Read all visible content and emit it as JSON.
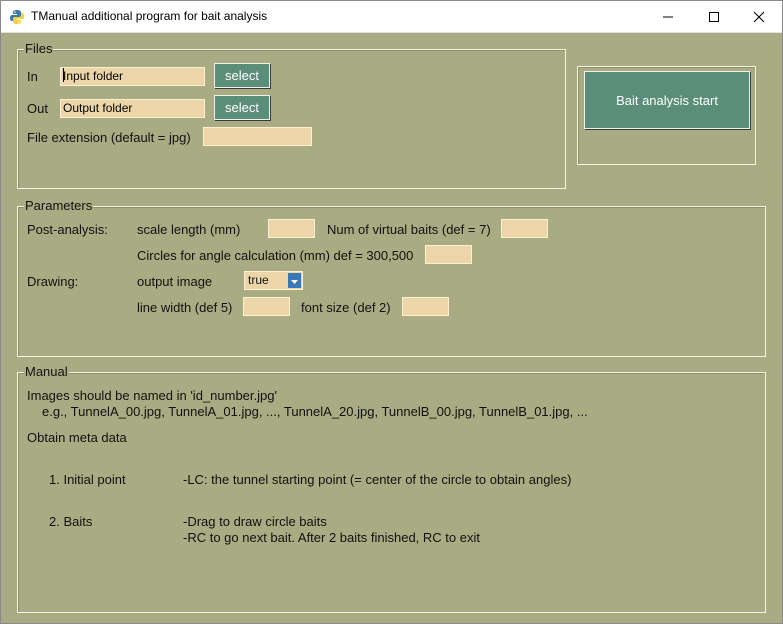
{
  "window": {
    "title": "TManual additional program for bait analysis"
  },
  "files": {
    "legend": "Files",
    "in_label": "In",
    "in_value": "Input folder",
    "out_label": "Out",
    "out_value": "Output folder",
    "select_label": "select",
    "ext_label": "File extension (default = jpg)",
    "ext_value": ""
  },
  "start_button": {
    "label": "Bait analysis start"
  },
  "params": {
    "legend": "Parameters",
    "post_label": "Post-analysis:",
    "scale_label": "scale length (mm)",
    "num_baits_label": "Num of virtual baits (def = 7)",
    "circles_label": "Circles for angle calculation (mm) def = 300,500",
    "drawing_label": "Drawing:",
    "output_image_label": "output image",
    "output_image_value": "true",
    "line_width_label": "line width (def 5)",
    "font_size_label": "font size (def 2)"
  },
  "manual": {
    "legend": "Manual",
    "line1": "Images should be named in 'id_number.jpg'",
    "line2": "e.g., TunnelA_00.jpg, TunnelA_01.jpg, ..., TunnelA_20.jpg, TunnelB_00.jpg, TunnelB_01.jpg, ...",
    "line3": "Obtain meta data",
    "step1_label": "1. Initial point",
    "step1_desc": "-LC: the tunnel starting point (= center of the circle to obtain angles)",
    "step2_label": "2. Baits",
    "step2_desc1": "-Drag to draw circle baits",
    "step2_desc2": "-RC to go next bait. After 2 baits finished, RC to exit"
  },
  "colors": {
    "background": "#a9ac82",
    "field": "#ecd6a9",
    "button": "#5a8d7a",
    "dropdown_arrow": "#3b78b8"
  }
}
